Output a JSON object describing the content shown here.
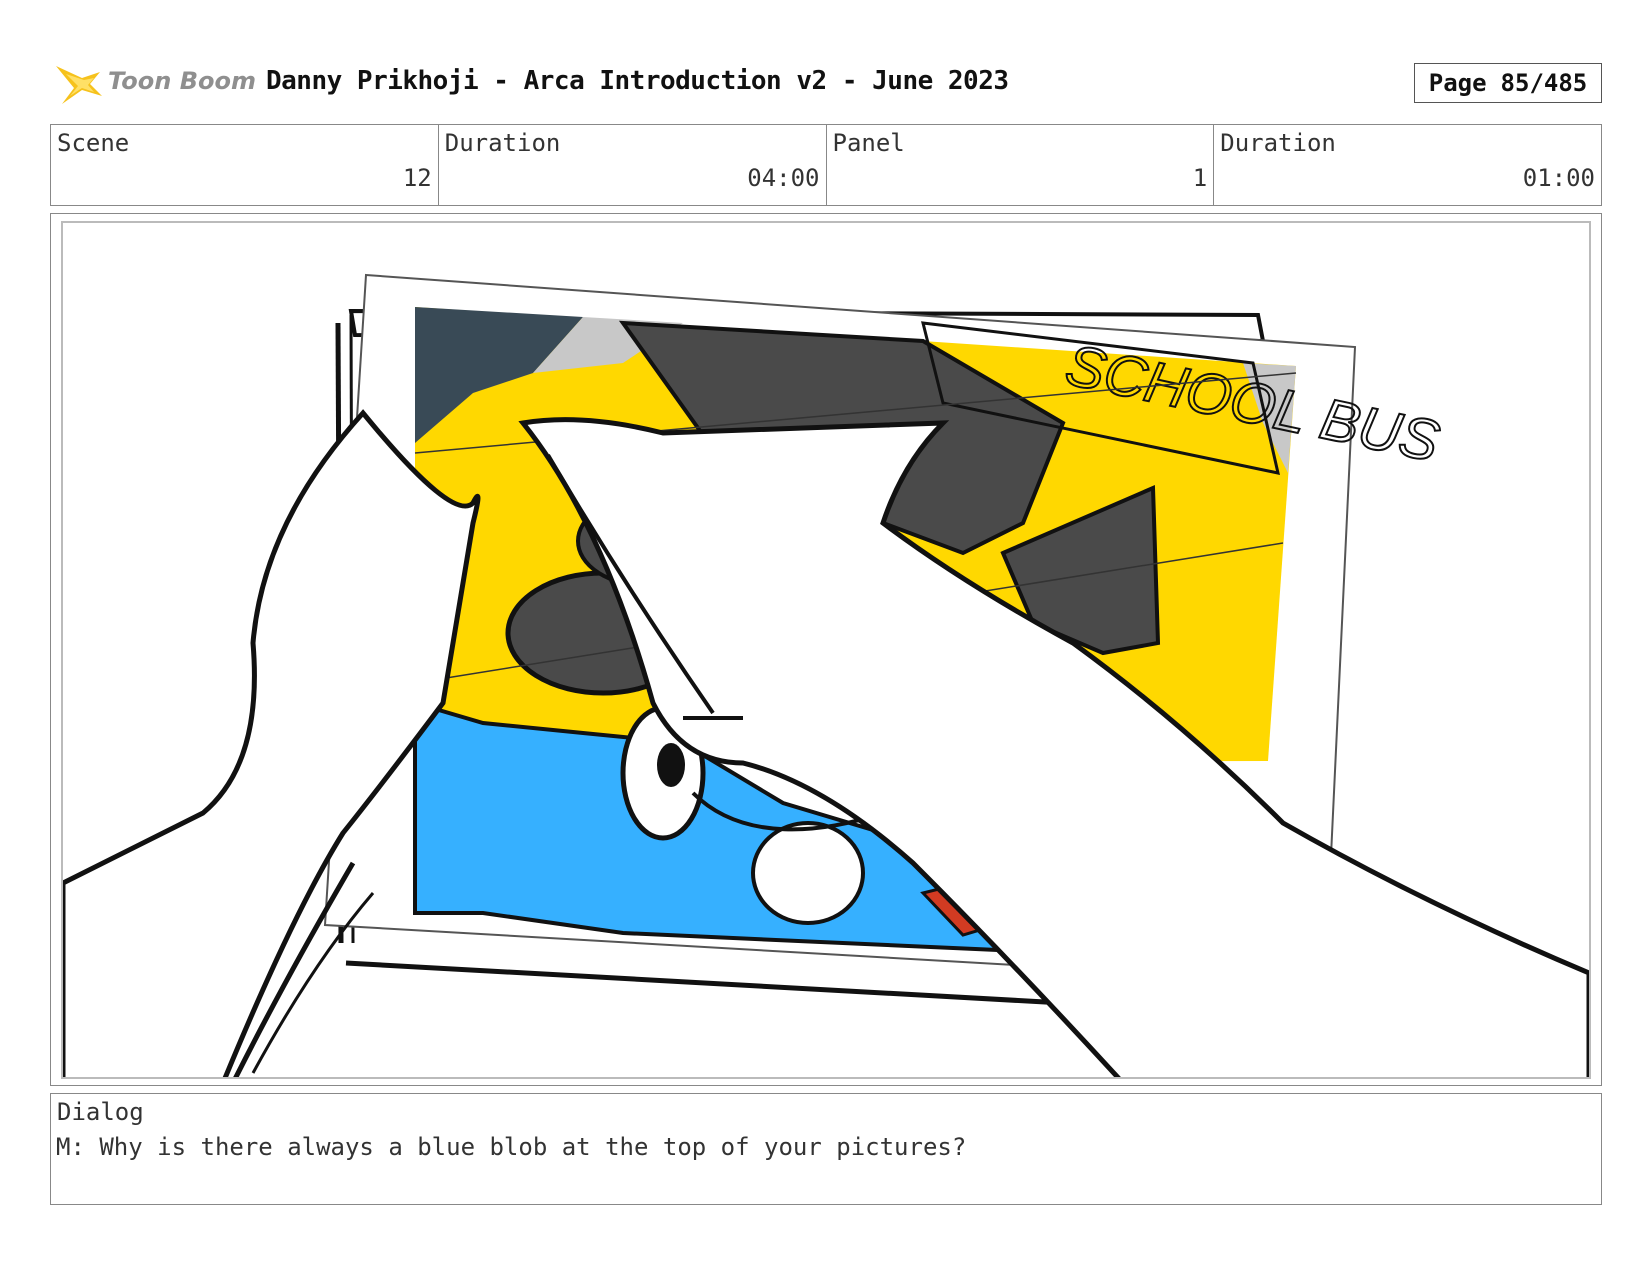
{
  "header": {
    "logo_text": "Toon Boom",
    "title": "Danny Prikhoji - Arca Introduction v2 - June 2023",
    "page_label": "Page",
    "page_value": "85/485"
  },
  "info": {
    "scene_label": "Scene",
    "scene_value": "12",
    "scene_duration_label": "Duration",
    "scene_duration_value": "04:00",
    "panel_label": "Panel",
    "panel_value": "1",
    "panel_duration_label": "Duration",
    "panel_duration_value": "01:00"
  },
  "panel": {
    "sign_text": "SCHOOL BUS",
    "colors": {
      "yellow": "#ffd800",
      "blue": "#36b0ff",
      "dark_gray": "#4a4a4a",
      "slate": "#394a56",
      "red": "#d23b22",
      "light_gray": "#c8c8c8"
    }
  },
  "dialog": {
    "label": "Dialog",
    "text": "M: Why is there always a blue blob at the top of your pictures?"
  }
}
